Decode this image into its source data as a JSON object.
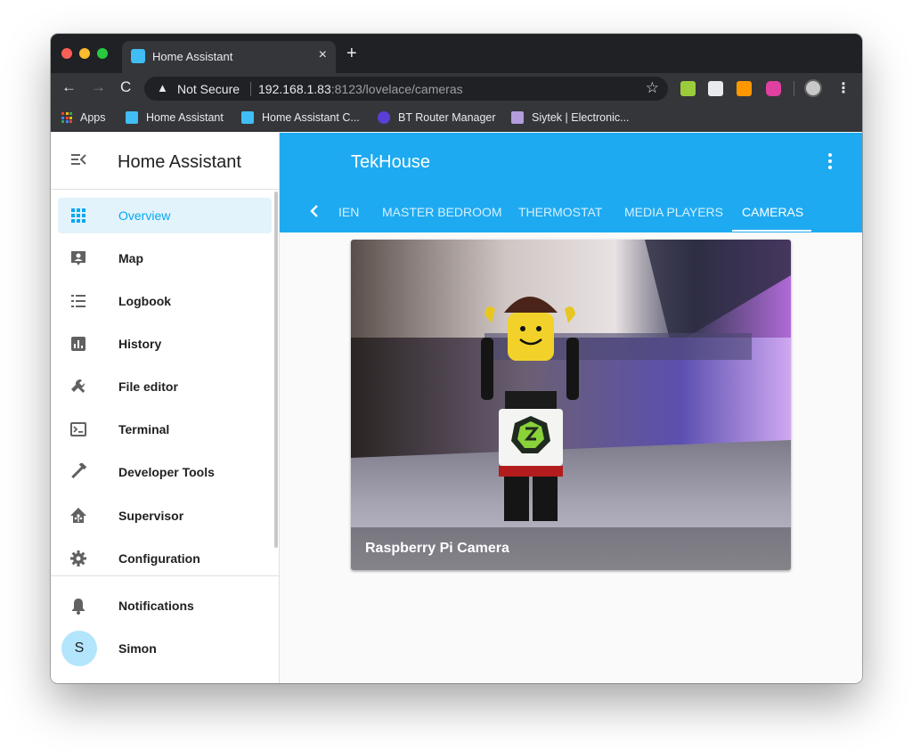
{
  "browser": {
    "tab_title": "Home Assistant",
    "tab_close": "×",
    "new_tab": "+",
    "nav_back": "←",
    "nav_forward": "→",
    "nav_reload": "C",
    "security_label": "Not Secure",
    "url_host": "192.168.1.83",
    "url_rest": ":8123/lovelace/cameras",
    "bookmark_star": "☆",
    "menu": "⋮",
    "bookmarks": [
      {
        "label": "Apps"
      },
      {
        "label": "Home Assistant"
      },
      {
        "label": "Home Assistant C..."
      },
      {
        "label": "BT Router Manager"
      },
      {
        "label": "Siytek | Electronic..."
      }
    ]
  },
  "sidebar": {
    "title": "Home Assistant",
    "items": [
      {
        "label": "Overview",
        "icon": "view-dashboard-icon",
        "active": true
      },
      {
        "label": "Map",
        "icon": "map-marker-icon"
      },
      {
        "label": "Logbook",
        "icon": "logbook-icon"
      },
      {
        "label": "History",
        "icon": "chart-bar-icon"
      },
      {
        "label": "File editor",
        "icon": "wrench-icon"
      },
      {
        "label": "Terminal",
        "icon": "console-icon"
      },
      {
        "label": "Developer Tools",
        "icon": "hammer-icon"
      },
      {
        "label": "Supervisor",
        "icon": "home-assistant-icon"
      },
      {
        "label": "Configuration",
        "icon": "cog-icon"
      }
    ],
    "notifications_label": "Notifications",
    "user": {
      "name": "Simon",
      "initial": "S"
    }
  },
  "header": {
    "title": "TekHouse",
    "tabs": [
      "IEN",
      "MASTER BEDROOM",
      "THERMOSTAT",
      "MEDIA PLAYERS",
      "CAMERAS"
    ],
    "active_tab": "CAMERAS"
  },
  "camera_card": {
    "name": "Raspberry Pi Camera"
  },
  "colors": {
    "accent": "#03a9f4",
    "header_bg": "#1eaaf1",
    "chrome_dark": "#202124"
  }
}
